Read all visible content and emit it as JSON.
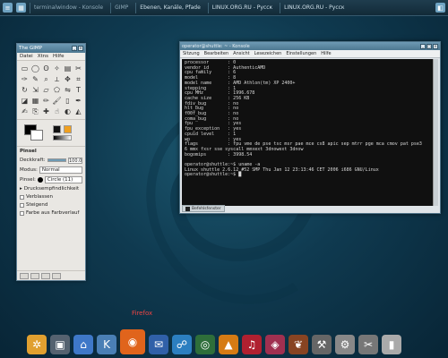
{
  "topbar": {
    "tasks": [
      {
        "label": "terminalwindow - Konsole",
        "dim": true
      },
      {
        "label": "GIMP",
        "dim": true
      },
      {
        "label": "Ebenen, Kanäle, Pfade",
        "dim": false
      },
      {
        "label": "LINUX.ORG.RU - Русск",
        "dim": false
      },
      {
        "label": "LINUX.ORG.RU - Русск",
        "dim": false
      }
    ]
  },
  "gimp": {
    "title": "The GIMP",
    "menu": [
      "Datei",
      "Xtns",
      "Hilfe"
    ],
    "options_title": "Pinsel",
    "opacity_label": "Deckkraft:",
    "opacity_value": "100.0",
    "opacity_percent": 100,
    "mode_label": "Modus:",
    "mode_value": "Normal",
    "brush_label": "Pinsel:",
    "brush_value": "Circle (11)",
    "pressure_label": "Drucksempfindlichkeit",
    "checkboxes": [
      "Verblassen",
      "Steigend",
      "Farbe aus Farbverlauf"
    ]
  },
  "terminal": {
    "title": "operator@shuttle: ~ - Konsole",
    "menu": [
      "Sitzung",
      "Bearbeiten",
      "Ansicht",
      "Lesezeichen",
      "Einstellungen",
      "Hilfe"
    ],
    "lines": [
      "processor       : 0",
      "vendor_id       : AuthenticAMD",
      "cpu family      : 6",
      "model           : 8",
      "model name      : AMD Athlon(tm) XP 2400+",
      "stepping        : 1",
      "cpu MHz         : 1996.678",
      "cache size      : 256 KB",
      "fdiv_bug        : no",
      "hlt_bug         : no",
      "f00f_bug        : no",
      "coma_bug        : no",
      "fpu             : yes",
      "fpu_exception   : yes",
      "cpuid level     : 1",
      "wp              : yes",
      "flags           : fpu vme de pse tsc msr pae mce cx8 apic sep mtrr pge mca cmov pat pse3",
      "6 mmx fxsr sse syscall mmxext 3dnowext 3dnow",
      "bogomips        : 3998.54",
      "",
      "operator@shuttle:~$ uname -a",
      "Linux shuttle 2.6.12 #52 SMP Thu Jan 12 23:13:46 CET 2006 i686 GNU/Linux",
      "operator@shuttle:~$ █"
    ],
    "tab_label": "Befehlsfenster"
  },
  "dock": {
    "active_label": "Firefox",
    "items": [
      {
        "icon": "gear-icon",
        "glyph": "✲",
        "color": "#e0a030"
      },
      {
        "icon": "monitor-icon",
        "glyph": "▣",
        "color": "#556270"
      },
      {
        "icon": "home-icon",
        "glyph": "⌂",
        "color": "#3e78c8"
      },
      {
        "icon": "kde-icon",
        "glyph": "K",
        "color": "#4a7fb5"
      },
      {
        "icon": "firefox-icon",
        "glyph": "◉",
        "color": "#e0641c"
      },
      {
        "icon": "thunderbird-icon",
        "glyph": "✉",
        "color": "#3060a8"
      },
      {
        "icon": "network-icon",
        "glyph": "☍",
        "color": "#2c7fc0"
      },
      {
        "icon": "disc-icon",
        "glyph": "◎",
        "color": "#2e6e3a"
      },
      {
        "icon": "vlc-icon",
        "glyph": "▲",
        "color": "#d57b14"
      },
      {
        "icon": "media-icon",
        "glyph": "♫",
        "color": "#b02030"
      },
      {
        "icon": "cube-icon",
        "glyph": "◈",
        "color": "#a03050"
      },
      {
        "icon": "wine-icon",
        "glyph": "❦",
        "color": "#884422"
      },
      {
        "icon": "tools-icon",
        "glyph": "⚒",
        "color": "#666"
      },
      {
        "icon": "utility-icon",
        "glyph": "⚙",
        "color": "#888"
      },
      {
        "icon": "settings-icon",
        "glyph": "✂",
        "color": "#777"
      },
      {
        "icon": "trash-icon",
        "glyph": "▮",
        "color": "#aaa"
      }
    ]
  }
}
